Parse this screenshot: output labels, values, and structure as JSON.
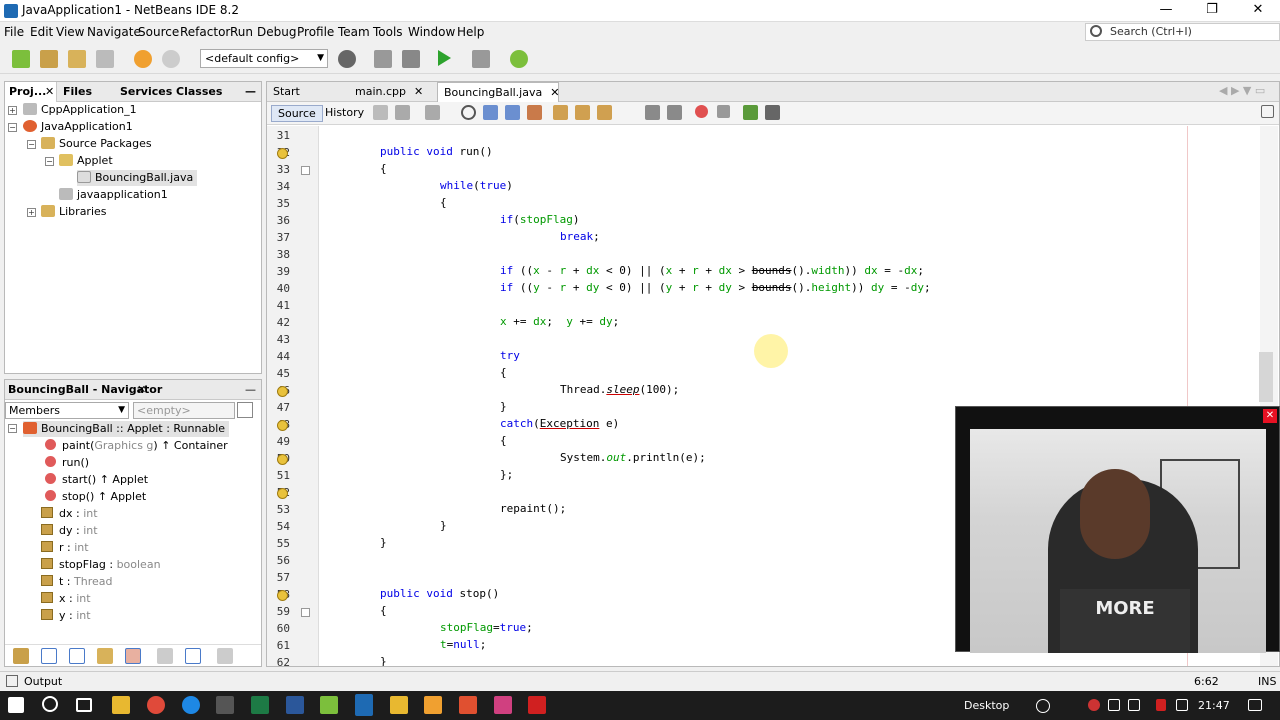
{
  "window": {
    "title": "JavaApplication1 - NetBeans IDE 8.2"
  },
  "menu": [
    "File",
    "Edit",
    "View",
    "Navigate",
    "Source",
    "Refactor",
    "Run",
    "Debug",
    "Profile",
    "Team",
    "Tools",
    "Window",
    "Help"
  ],
  "search": {
    "placeholder": "Search (Ctrl+I)"
  },
  "toolbar": {
    "config": "<default config>"
  },
  "projects": {
    "tabs": [
      "Proj...",
      "Files",
      "Services",
      "Classes"
    ],
    "tree": [
      "CppApplication_1",
      "JavaApplication1",
      "Source Packages",
      "Applet",
      "BouncingBall.java",
      "javaapplication1",
      "Libraries"
    ]
  },
  "navigator": {
    "title": "BouncingBall - Navigator",
    "filter": "Members",
    "empty": "<empty>",
    "root": "BouncingBall :: Applet : Runnable",
    "members": [
      {
        "name": "paint(",
        "sig": "Graphics g",
        "tail": ") ↑ Container"
      },
      {
        "name": "run()",
        "sig": "",
        "tail": ""
      },
      {
        "name": "start() ↑ Applet",
        "sig": "",
        "tail": ""
      },
      {
        "name": "stop() ↑ Applet",
        "sig": "",
        "tail": ""
      },
      {
        "name": "dx : ",
        "sig": "int",
        "tail": ""
      },
      {
        "name": "dy : ",
        "sig": "int",
        "tail": ""
      },
      {
        "name": "r : ",
        "sig": "int",
        "tail": ""
      },
      {
        "name": "stopFlag : ",
        "sig": "boolean",
        "tail": ""
      },
      {
        "name": "t : ",
        "sig": "Thread",
        "tail": ""
      },
      {
        "name": "x : ",
        "sig": "int",
        "tail": ""
      },
      {
        "name": "y : ",
        "sig": "int",
        "tail": ""
      }
    ]
  },
  "editor": {
    "tabs": [
      "Start Page",
      "main.cpp",
      "BouncingBall.java"
    ],
    "source_label": "Source",
    "history_label": "History",
    "line_numbers": [
      "31",
      "32",
      "33",
      "34",
      "35",
      "36",
      "37",
      "38",
      "39",
      "40",
      "41",
      "42",
      "43",
      "44",
      "45",
      "46",
      "47",
      "48",
      "49",
      "50",
      "51",
      "52",
      "53",
      "54",
      "55",
      "56",
      "57",
      "58",
      "59",
      "60",
      "61",
      "62"
    ]
  },
  "status": {
    "output": "Output",
    "position": "6:62",
    "mode": "INS"
  },
  "taskbar": {
    "desktop": "Desktop",
    "time": "21:47"
  },
  "colors": {
    "keyword": "#0000e6",
    "field": "#009900",
    "accent": "#1e6ab3"
  }
}
